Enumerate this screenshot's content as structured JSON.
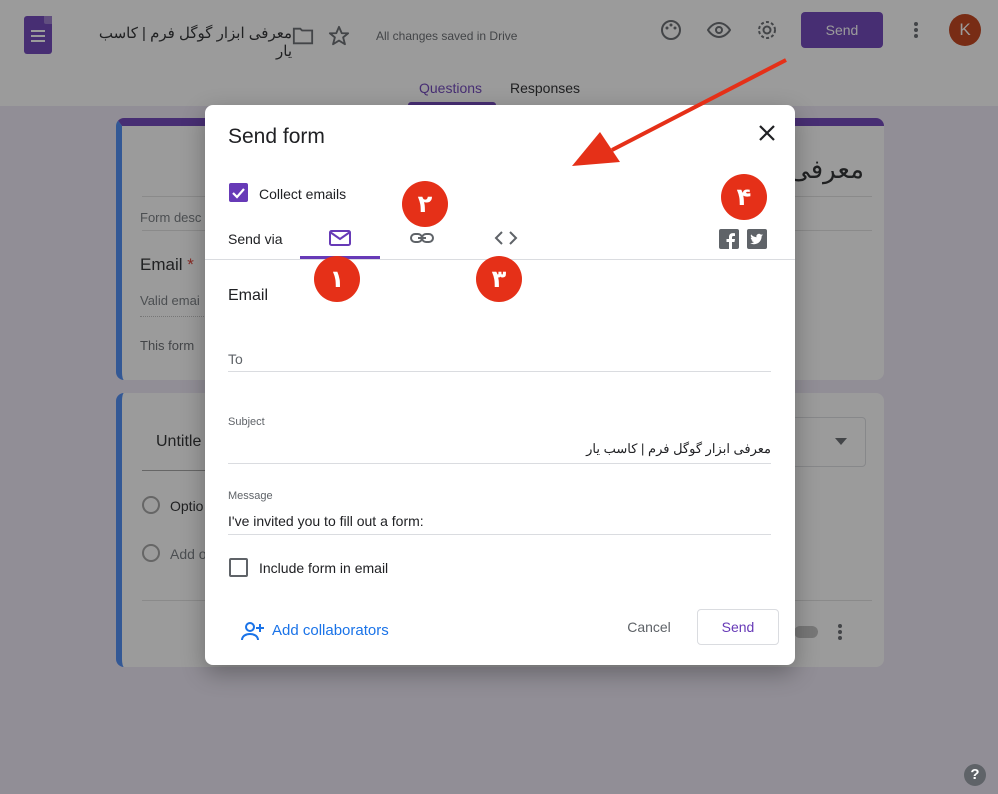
{
  "header": {
    "doc_title": "معرفی ابزار گوگل فرم | کاسب یار",
    "saved_status": "All changes saved in Drive",
    "send_label": "Send",
    "avatar_letter": "K",
    "accent_color": "#673ab7"
  },
  "tabs": [
    {
      "label": "Questions",
      "active": true
    },
    {
      "label": "Responses",
      "active": false
    }
  ],
  "background_form": {
    "title_fragment": "معرفی",
    "description_placeholder": "Form desc",
    "email_label": "Email",
    "email_required_mark": "*",
    "email_placeholder": "Valid emai",
    "collect_note": "This form",
    "question_title": "Untitle",
    "option_1": "Optio",
    "option_add": "Add o"
  },
  "dialog": {
    "title": "Send form",
    "collect_emails_label": "Collect emails",
    "collect_emails_checked": true,
    "send_via_label": "Send via",
    "send_via_options": [
      "email-icon",
      "link-icon",
      "embed-icon"
    ],
    "send_via_selected": "email-icon",
    "social": [
      "facebook-icon",
      "twitter-icon"
    ],
    "email_heading": "Email",
    "to_label": "To",
    "to_value": "",
    "subject_label": "Subject",
    "subject_value": "معرفی ابزار گوگل فرم | کاسب یار",
    "message_label": "Message",
    "message_value": "I've invited you to fill out a form:",
    "include_form_label": "Include form in email",
    "include_form_checked": false,
    "add_collaborators_label": "Add collaborators",
    "cancel_label": "Cancel",
    "send_label": "Send"
  },
  "annotations": {
    "badge_1": "۱",
    "badge_2": "۲",
    "badge_3": "۳",
    "badge_4": "۴",
    "annotation_color": "#e53018"
  },
  "help_label": "?"
}
